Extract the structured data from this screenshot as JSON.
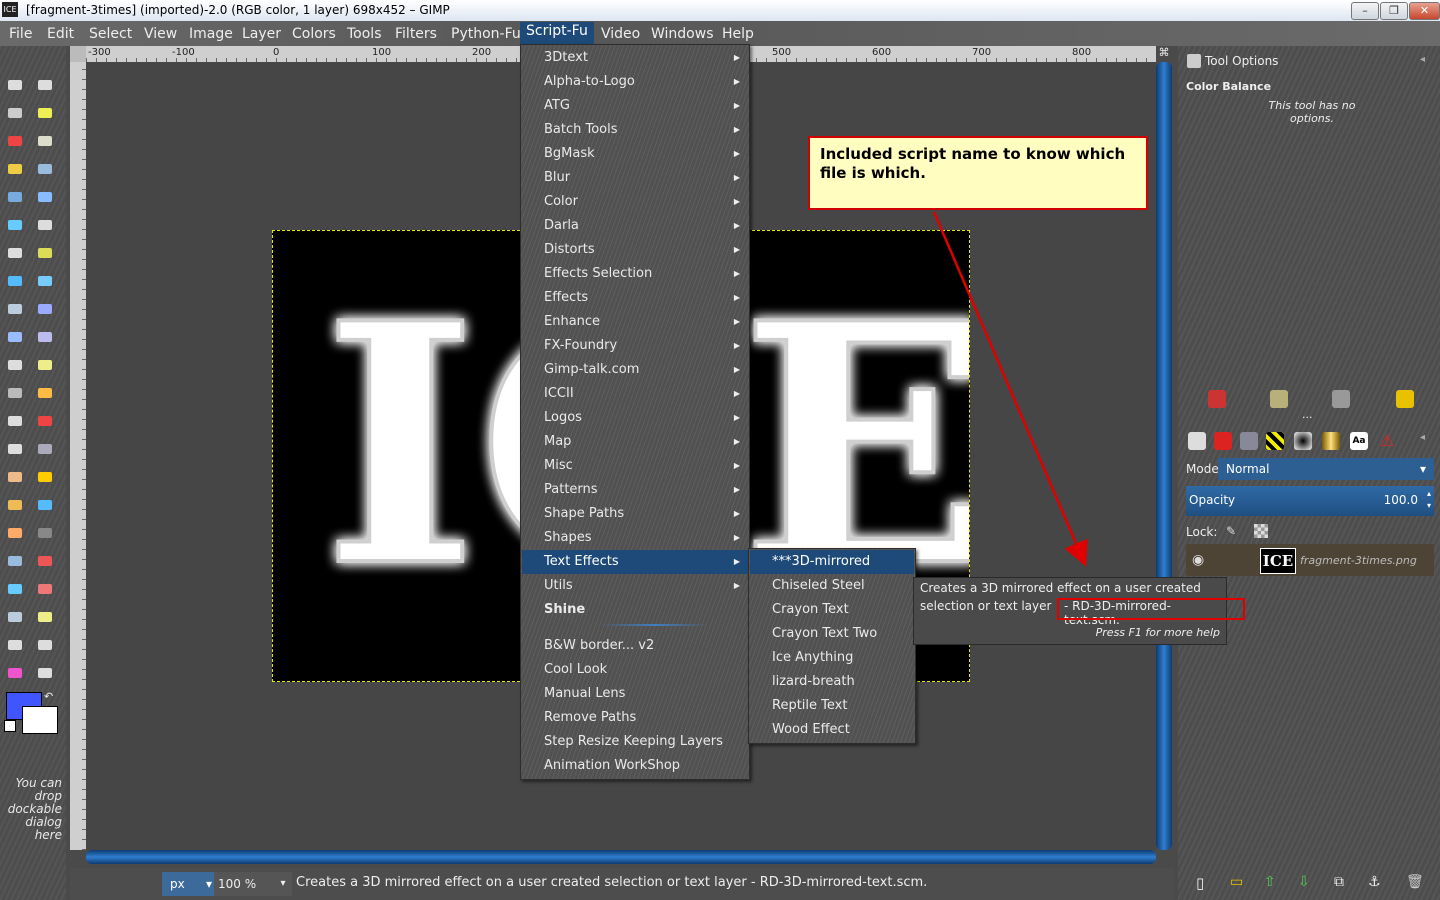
{
  "window": {
    "title": "[fragment-3times] (imported)-2.0 (RGB color, 1 layer) 698x452 – GIMP",
    "app_icon": "ICE",
    "minimize": "–",
    "maximize": "❐",
    "close": "✕"
  },
  "menubar": [
    "File",
    "Edit",
    "Select",
    "View",
    "Image",
    "Layer",
    "Colors",
    "Tools",
    "Filters",
    "Python-Fu",
    "Script-Fu",
    "Video",
    "Windows",
    "Help"
  ],
  "ruler": [
    "-300",
    "-100",
    "0",
    "100",
    "200",
    "500",
    "600",
    "700",
    "800"
  ],
  "scriptfu_menu": [
    {
      "label": "3Dtext",
      "submenu": true
    },
    {
      "label": "Alpha-to-Logo",
      "submenu": true
    },
    {
      "label": "ATG",
      "submenu": true
    },
    {
      "label": "Batch Tools",
      "submenu": true
    },
    {
      "label": "BgMask",
      "submenu": true
    },
    {
      "label": "Blur",
      "submenu": true
    },
    {
      "label": "Color",
      "submenu": true
    },
    {
      "label": "Darla",
      "submenu": true
    },
    {
      "label": "Distorts",
      "submenu": true
    },
    {
      "label": "Effects Selection",
      "submenu": true
    },
    {
      "label": "Effects",
      "submenu": true
    },
    {
      "label": "Enhance",
      "submenu": true
    },
    {
      "label": "FX-Foundry",
      "submenu": true
    },
    {
      "label": "Gimp-talk.com",
      "submenu": true
    },
    {
      "label": "ICCII",
      "submenu": true
    },
    {
      "label": "Logos",
      "submenu": true
    },
    {
      "label": "Map",
      "submenu": true
    },
    {
      "label": "Misc",
      "submenu": true
    },
    {
      "label": "Patterns",
      "submenu": true
    },
    {
      "label": "Shape Paths",
      "submenu": true
    },
    {
      "label": "Shapes",
      "submenu": true
    },
    {
      "label": "Text Effects",
      "submenu": true
    },
    {
      "label": "Utils",
      "submenu": true
    },
    {
      "label": "Shine",
      "submenu": false
    }
  ],
  "scriptfu_extra": [
    "B&W border... v2",
    "Cool Look",
    "Manual Lens",
    "Remove Paths",
    "Step Resize Keeping Layers",
    "Animation WorkShop"
  ],
  "text_effects_menu": [
    "***3D-mirrored",
    "Chiseled Steel",
    "Crayon Text",
    "Crayon Text Two",
    "Ice Anything",
    "lizard-breath",
    "Reptile Text",
    "Wood Effect"
  ],
  "tooltip": {
    "line1": "Creates a 3D mirrored effect on a user created",
    "line2a": "selection or text layer",
    "line2b": "- RD-3D-mirrored-text.scm.",
    "help": "Press F1 for more help"
  },
  "callout": "Included script name to know which file is which.",
  "image_text": "ICE",
  "toolbox": {
    "drop_hint": "You can drop dockable dialog here"
  },
  "dock": {
    "tool_options_title": "Tool Options",
    "tool_name": "Color Balance",
    "no_options": "This tool has no options.",
    "mode_label": "Mode:",
    "mode_value": "Normal",
    "opacity_label": "Opacity",
    "opacity_value": "100.0",
    "lock_label": "Lock:",
    "layer_name": "fragment-3times.png",
    "layer_thumb": "ICE",
    "ellipsis": "..."
  },
  "statusbar": {
    "unit": "px",
    "zoom": "100",
    "zoom_unit": "%",
    "message": "Creates a 3D mirrored effect on a user created selection or text layer - RD-3D-mirrored-text.scm."
  },
  "colors": {
    "accent": "#1d4a78",
    "fg": "#3f55ff",
    "bg": "#ffffff",
    "callout_border": "#d00000",
    "callout_fill": "#fffdc0"
  }
}
